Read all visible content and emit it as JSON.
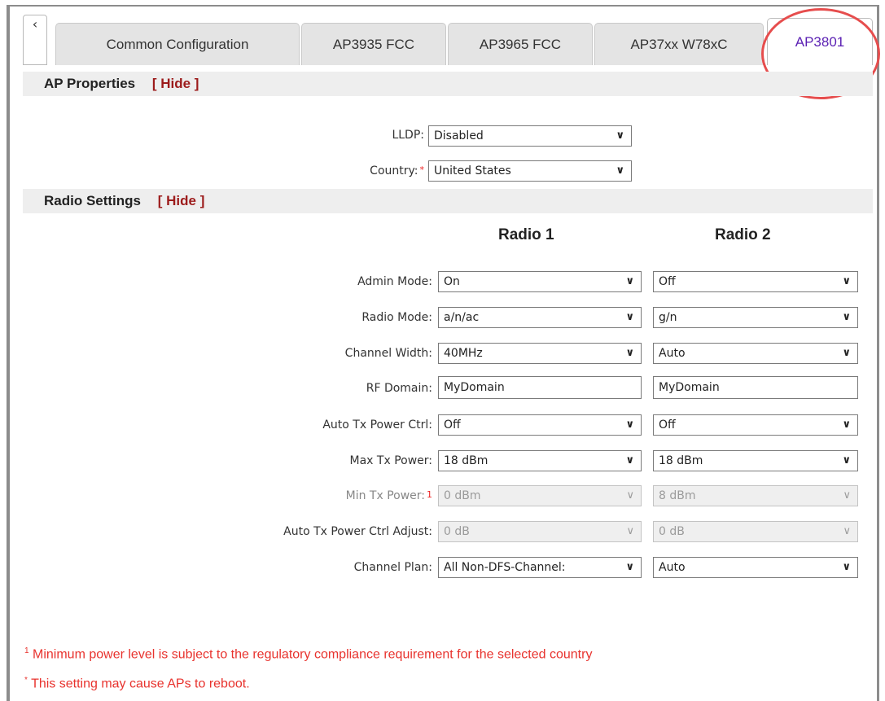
{
  "tabs": {
    "scroll_icon": "‹",
    "items": [
      {
        "label": "Common Configuration"
      },
      {
        "label": "AP3935 FCC"
      },
      {
        "label": "AP3965 FCC"
      },
      {
        "label": "AP37xx W78xC"
      },
      {
        "label": "AP3801"
      }
    ],
    "active_index": 4
  },
  "ap_properties": {
    "title": "AP Properties",
    "hide_label": "[ Hide ]",
    "lldp": {
      "label": "LLDP:",
      "value": "Disabled"
    },
    "country": {
      "label": "Country:",
      "required_mark": "*",
      "value": "United States"
    }
  },
  "radio_settings": {
    "title": "Radio Settings",
    "hide_label": "[ Hide ]",
    "radio1_header": "Radio 1",
    "radio2_header": "Radio 2",
    "rows": {
      "admin_mode": {
        "label": "Admin Mode:",
        "r1": "On",
        "r2": "Off"
      },
      "radio_mode": {
        "label": "Radio Mode:",
        "r1": "a/n/ac",
        "r2": "g/n"
      },
      "channel_width": {
        "label": "Channel Width:",
        "r1": "40MHz",
        "r2": "Auto"
      },
      "rf_domain": {
        "label": "RF Domain:",
        "r1": "MyDomain",
        "r2": "MyDomain"
      },
      "auto_tx_power_ctrl": {
        "label": "Auto Tx Power Ctrl:",
        "r1": "Off",
        "r2": "Off"
      },
      "max_tx_power": {
        "label": "Max Tx Power:",
        "r1": "18 dBm",
        "r2": "18 dBm"
      },
      "min_tx_power": {
        "label": "Min Tx Power:",
        "footnote_mark": "1",
        "r1": "0 dBm",
        "r2": "8 dBm"
      },
      "auto_tx_power_ctrl_adjust": {
        "label": "Auto Tx Power Ctrl Adjust:",
        "r1": "0 dB",
        "r2": "0 dB"
      },
      "channel_plan": {
        "label": "Channel Plan:",
        "r1": "All Non-DFS-Channel:",
        "r2": "Auto"
      }
    }
  },
  "footnotes": {
    "note1_mark": "1",
    "note1": "Minimum power level is subject to the regulatory compliance requirement for the selected country",
    "note2_mark": "*",
    "note2": "This setting may cause APs to reboot."
  },
  "icons": {
    "dropdown": "chevron-down-icon",
    "dropdown_glyph": "❯"
  },
  "colors": {
    "accent_tab": "#5a1fb3",
    "hide_link": "#9c1b1b",
    "annotation": "#e64d4d",
    "note": "#e8332e"
  }
}
